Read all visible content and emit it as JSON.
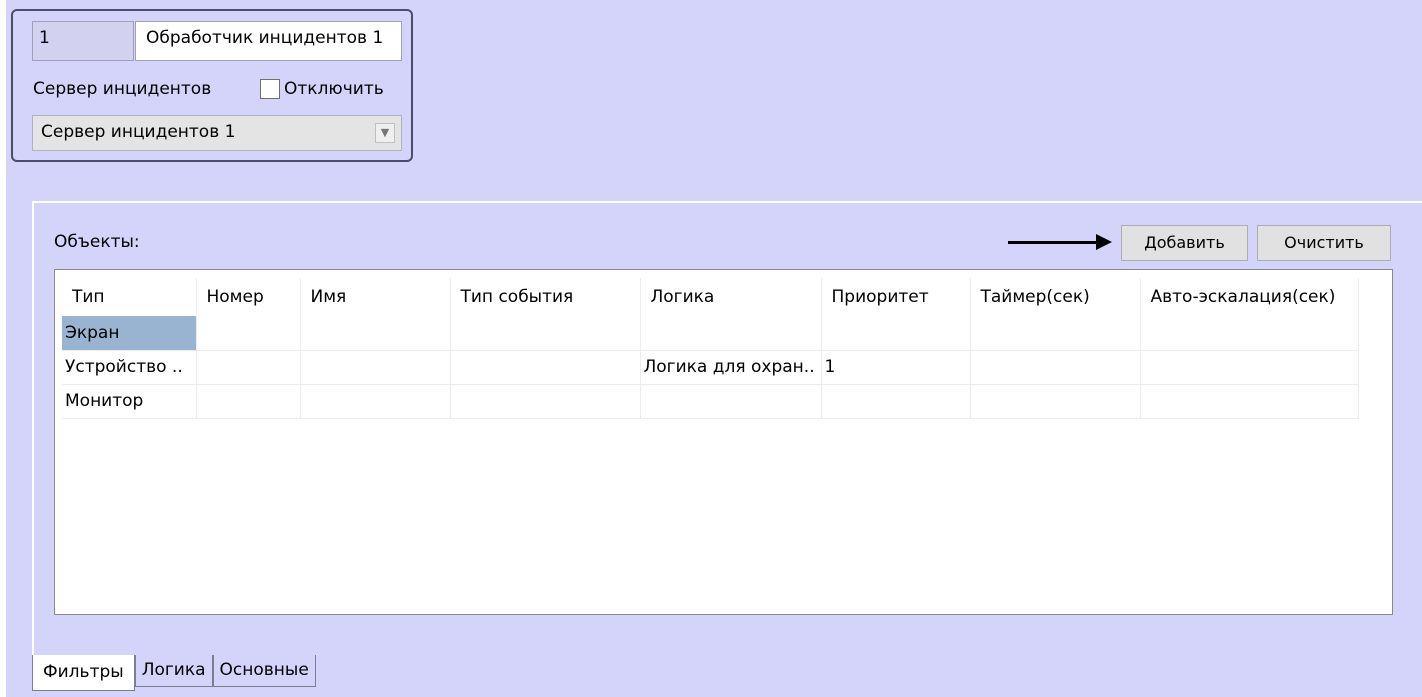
{
  "object_panel": {
    "id_value": "1",
    "name_value": "Обработчик инцидентов 1",
    "server_label": "Сервер инцидентов",
    "disable_label": "Отключить",
    "disable_checked": false,
    "server_selected": "Сервер инцидентов 1"
  },
  "objects": {
    "label": "Объекты:",
    "add_button": "Добавить",
    "clear_button": "Очистить",
    "columns": [
      "Тип",
      "Номер",
      "Имя",
      "Тип события",
      "Логика",
      "Приоритет",
      "Таймер(сек)",
      "Авто-эскалация(сек)"
    ],
    "rows": [
      [
        "Экран",
        "",
        "",
        "",
        "",
        "",
        "",
        ""
      ],
      [
        "Устройство ..",
        "",
        "",
        "",
        "Логика для охран..",
        "1",
        "",
        ""
      ],
      [
        "Монитор",
        "",
        "",
        "",
        "",
        "",
        "",
        ""
      ]
    ],
    "selected_row": 0
  },
  "tabs": [
    {
      "label": "Фильтры",
      "active": true
    },
    {
      "label": "Логика",
      "active": false
    },
    {
      "label": "Основные",
      "active": false
    }
  ],
  "colors": {
    "background": "#d4d4fb",
    "selection": "#99b4d1"
  }
}
